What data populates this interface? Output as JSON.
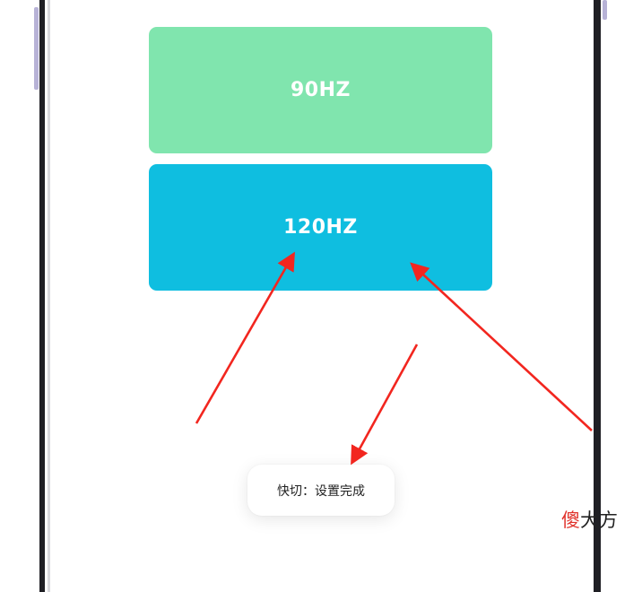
{
  "refresh_rate_options": [
    {
      "label": "90HZ",
      "color": "#80E5AE"
    },
    {
      "label": "120HZ",
      "color": "#0FBEE0"
    }
  ],
  "toast": {
    "text": "快切：设置完成"
  },
  "annotation": {
    "arrow_color": "#F2261F"
  },
  "watermark": {
    "part1": "傻",
    "part2": "大方"
  }
}
